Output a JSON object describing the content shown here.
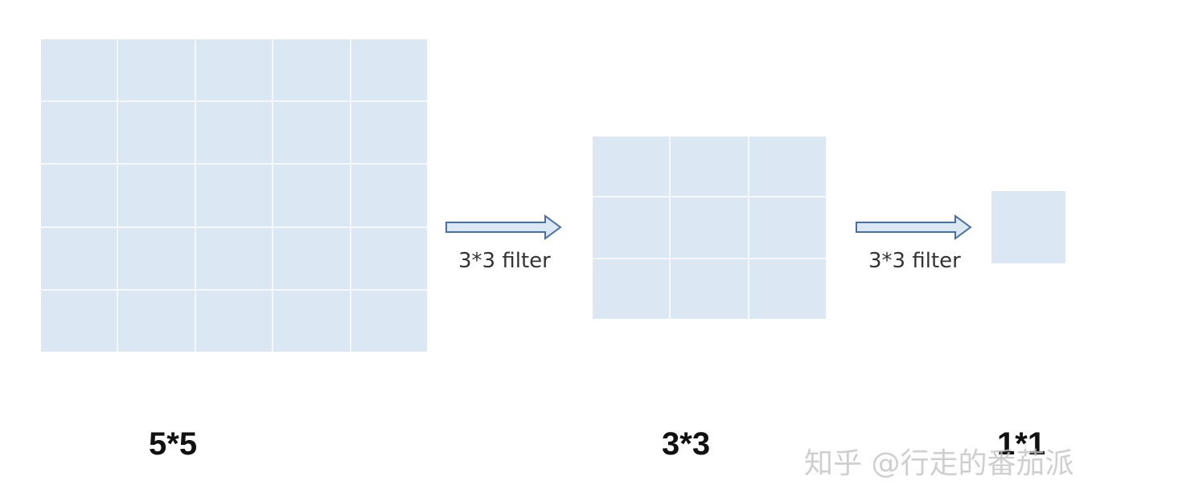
{
  "diagram": {
    "grids": [
      {
        "rows": 5,
        "cols": 5,
        "label": "5*5"
      },
      {
        "rows": 3,
        "cols": 3,
        "label": "3*3"
      },
      {
        "rows": 1,
        "cols": 1,
        "label": "1*1"
      }
    ],
    "arrows": [
      {
        "label": "3*3 filter"
      },
      {
        "label": "3*3 filter"
      }
    ],
    "colors": {
      "cell_fill": "#dce7f4",
      "grid_line": "#f4f8fc",
      "arrow_fill": "#dce7f4",
      "arrow_stroke": "#4a6fa5",
      "label_text": "#111111"
    }
  },
  "watermark": "知乎 @行走的番茄派"
}
